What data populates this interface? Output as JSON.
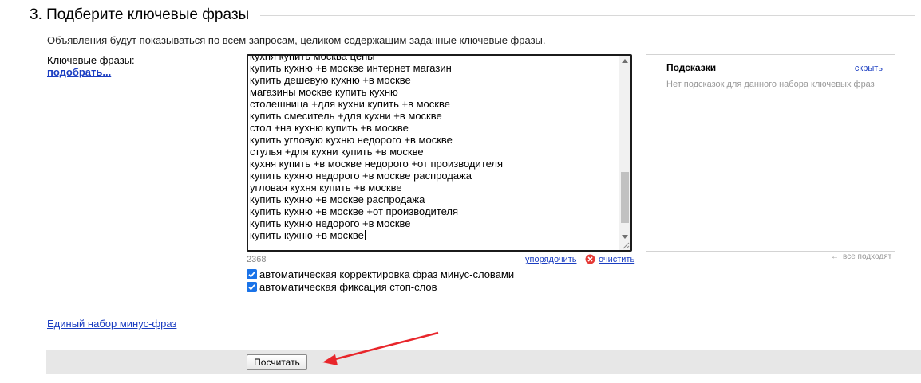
{
  "section": {
    "title": "3. Подберите ключевые фразы",
    "description": "Объявления будут показываться по всем запросам, целиком содержащим заданные ключевые фразы."
  },
  "keywords": {
    "label": "Ключевые фразы:",
    "pick_link": "подобрать...",
    "lines": [
      "кухня купить москва цены",
      "купить кухню +в москве интернет магазин",
      "купить дешевую кухню +в москве",
      "магазины москве купить кухню",
      "столешница +для кухни купить +в москве",
      "купить смеситель +для кухни +в москве",
      "стол +на кухню купить +в москве",
      "купить угловую кухню недорого +в москве",
      "стулья +для кухни купить +в москве",
      "кухня купить +в москве недорого +от производителя",
      "купить кухню недорого +в москве распродажа",
      "угловая кухня купить +в москве",
      "купить кухню +в москве распродажа",
      "купить кухню +в москве +от производителя",
      "купить кухню недорого +в москве",
      "купить кухню +в москве"
    ],
    "char_count": "2368",
    "sort_link": "упорядочить",
    "clear_link": "очистить",
    "clear_icon": "clear-x-circle-icon",
    "error_color": "#e53935"
  },
  "options": {
    "auto_correct_label": "автоматическая корректировка фраз минус-словами",
    "auto_correct_checked": true,
    "auto_fix_label": "автоматическая фиксация стоп-слов",
    "auto_fix_checked": true,
    "checkbox_color": "#1a73e8"
  },
  "hints": {
    "title": "Подсказки",
    "hide_link": "скрыть",
    "empty_text": "Нет подсказок для данного набора ключевых фраз",
    "all_fit_label": "все подходят",
    "all_fit_icon": "arrow-left-icon"
  },
  "minus_phrases_link": "Единый набор минус-фраз",
  "calculate_button": "Посчитать",
  "colors": {
    "link": "#1a3dc1",
    "annotation_arrow": "#e8262b",
    "footer_bar": "#e7e7e7"
  }
}
